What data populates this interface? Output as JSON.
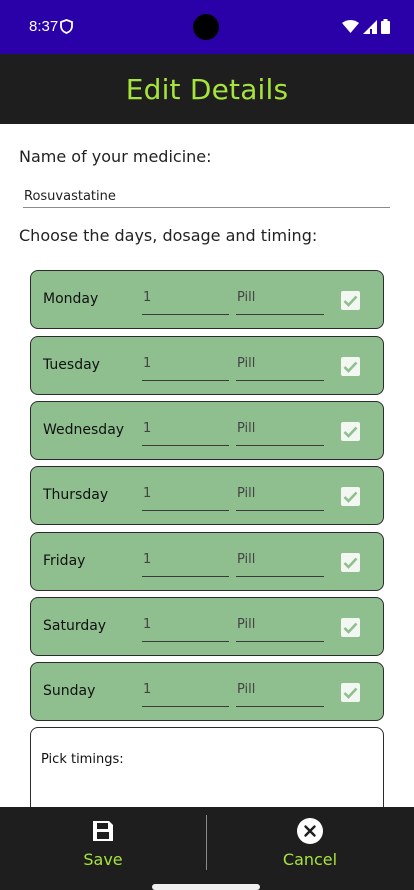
{
  "status": {
    "time": "8:37"
  },
  "header": {
    "title": "Edit Details"
  },
  "form": {
    "name_label": "Name of your medicine:",
    "name_value": "Rosuvastatine",
    "schedule_label": "Choose the days, dosage and timing:",
    "days": [
      {
        "day": "Monday",
        "dose": "1",
        "unit": "Pill",
        "checked": true
      },
      {
        "day": "Tuesday",
        "dose": "1",
        "unit": "Pill",
        "checked": true
      },
      {
        "day": "Wednesday",
        "dose": "1",
        "unit": "Pill",
        "checked": true
      },
      {
        "day": "Thursday",
        "dose": "1",
        "unit": "Pill",
        "checked": true
      },
      {
        "day": "Friday",
        "dose": "1",
        "unit": "Pill",
        "checked": true
      },
      {
        "day": "Saturday",
        "dose": "1",
        "unit": "Pill",
        "checked": true
      },
      {
        "day": "Sunday",
        "dose": "1",
        "unit": "Pill",
        "checked": true
      }
    ],
    "timings_label": "Pick timings:"
  },
  "actions": {
    "save_label": "Save",
    "save_icon": "floppy-disk-icon",
    "cancel_label": "Cancel",
    "cancel_icon": "close-circle-icon"
  },
  "colors": {
    "status_bar": "#2a00a8",
    "app_bar": "#1e1e1e",
    "accent": "#a6e43b",
    "day_card": "#8fbf8f"
  }
}
